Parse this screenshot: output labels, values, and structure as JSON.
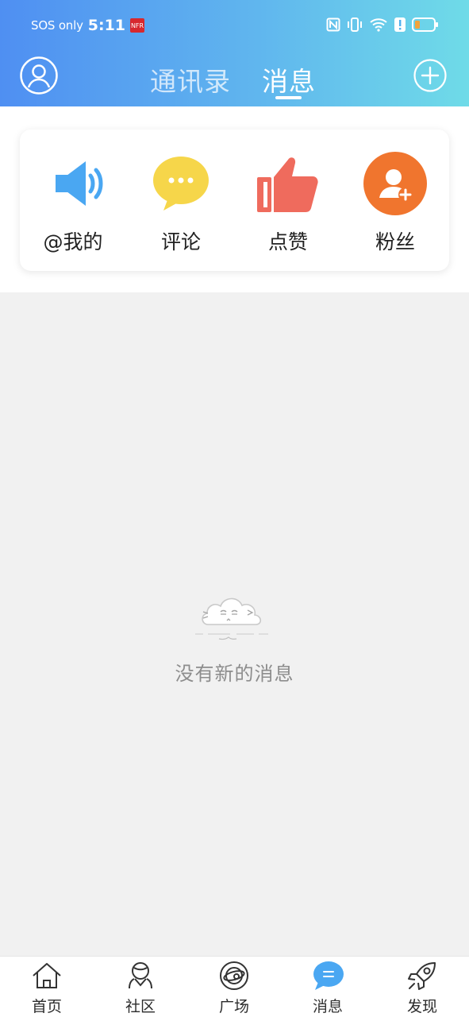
{
  "status_bar": {
    "carrier": "SOS only",
    "time": "5:11",
    "badge_text": "NFR",
    "icons": [
      "nfc-icon",
      "vibrate-icon",
      "wifi-icon",
      "battery-alert-icon",
      "battery-icon"
    ]
  },
  "header": {
    "tabs": [
      {
        "label": "通讯录",
        "active": false
      },
      {
        "label": "消息",
        "active": true
      }
    ],
    "left_icon": "user-avatar-icon",
    "right_icon": "add-circle-icon"
  },
  "quick_actions": [
    {
      "label": "@我的",
      "icon": "megaphone-icon",
      "color": "#4aa7f2"
    },
    {
      "label": "评论",
      "icon": "chat-bubble-icon",
      "color": "#f6d64a"
    },
    {
      "label": "点赞",
      "icon": "thumbs-up-icon",
      "color": "#ef6b5d"
    },
    {
      "label": "粉丝",
      "icon": "add-user-icon",
      "color": "#f0752e"
    }
  ],
  "empty_state": {
    "text": "没有新的消息",
    "icon": "sleepy-cloud-icon"
  },
  "bottom_nav": [
    {
      "label": "首页",
      "icon": "home-icon",
      "active": false
    },
    {
      "label": "社区",
      "icon": "community-icon",
      "active": false
    },
    {
      "label": "广场",
      "icon": "planet-icon",
      "active": false
    },
    {
      "label": "消息",
      "icon": "message-icon",
      "active": true
    },
    {
      "label": "发现",
      "icon": "rocket-icon",
      "active": false
    }
  ],
  "colors": {
    "header_gradient_start": "#4f8ff2",
    "header_gradient_end": "#6fdbe8",
    "page_background": "#f1f1f1",
    "active_nav": "#4aa7f2"
  }
}
